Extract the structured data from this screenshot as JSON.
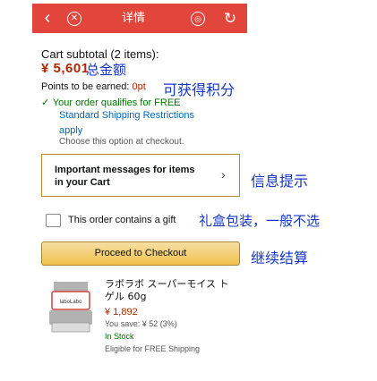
{
  "topbar": {
    "back_icon": "back-icon",
    "close_icon": "close-icon",
    "title": "详情",
    "globe_icon": "globe-icon",
    "refresh_icon": "refresh-icon",
    "color": "#e1453b"
  },
  "cart": {
    "subtotal_label": "Cart subtotal (2 items):",
    "subtotal_amount": "¥ 5,601",
    "points_label": "Points to be earned:",
    "points_value": "0pt",
    "qualify_text": "Your order qualifies for FREE",
    "shipping_link": "Standard Shipping Restrictions",
    "apply_text": "apply",
    "choose_text": "Choose this option at checkout."
  },
  "messages": {
    "label": "Important messages for items in your Cart",
    "arrow": "›"
  },
  "gift": {
    "label": "This order contains a gift"
  },
  "checkout": {
    "label": "Proceed to Checkout"
  },
  "annotations": {
    "total": "总金额",
    "points": "可获得积分",
    "messages": "信息提示",
    "gift": "礼盒包装，一般不选",
    "checkout": "继续结算"
  },
  "product": {
    "name": "ラボラボ スーパーモイス トゲル 60g",
    "price": "¥ 1,892",
    "save": "You save: ¥ 52 (3%)",
    "stock": "In Stock",
    "shipping": "Eligible for FREE Shipping",
    "brand_label": "laboLabo"
  }
}
